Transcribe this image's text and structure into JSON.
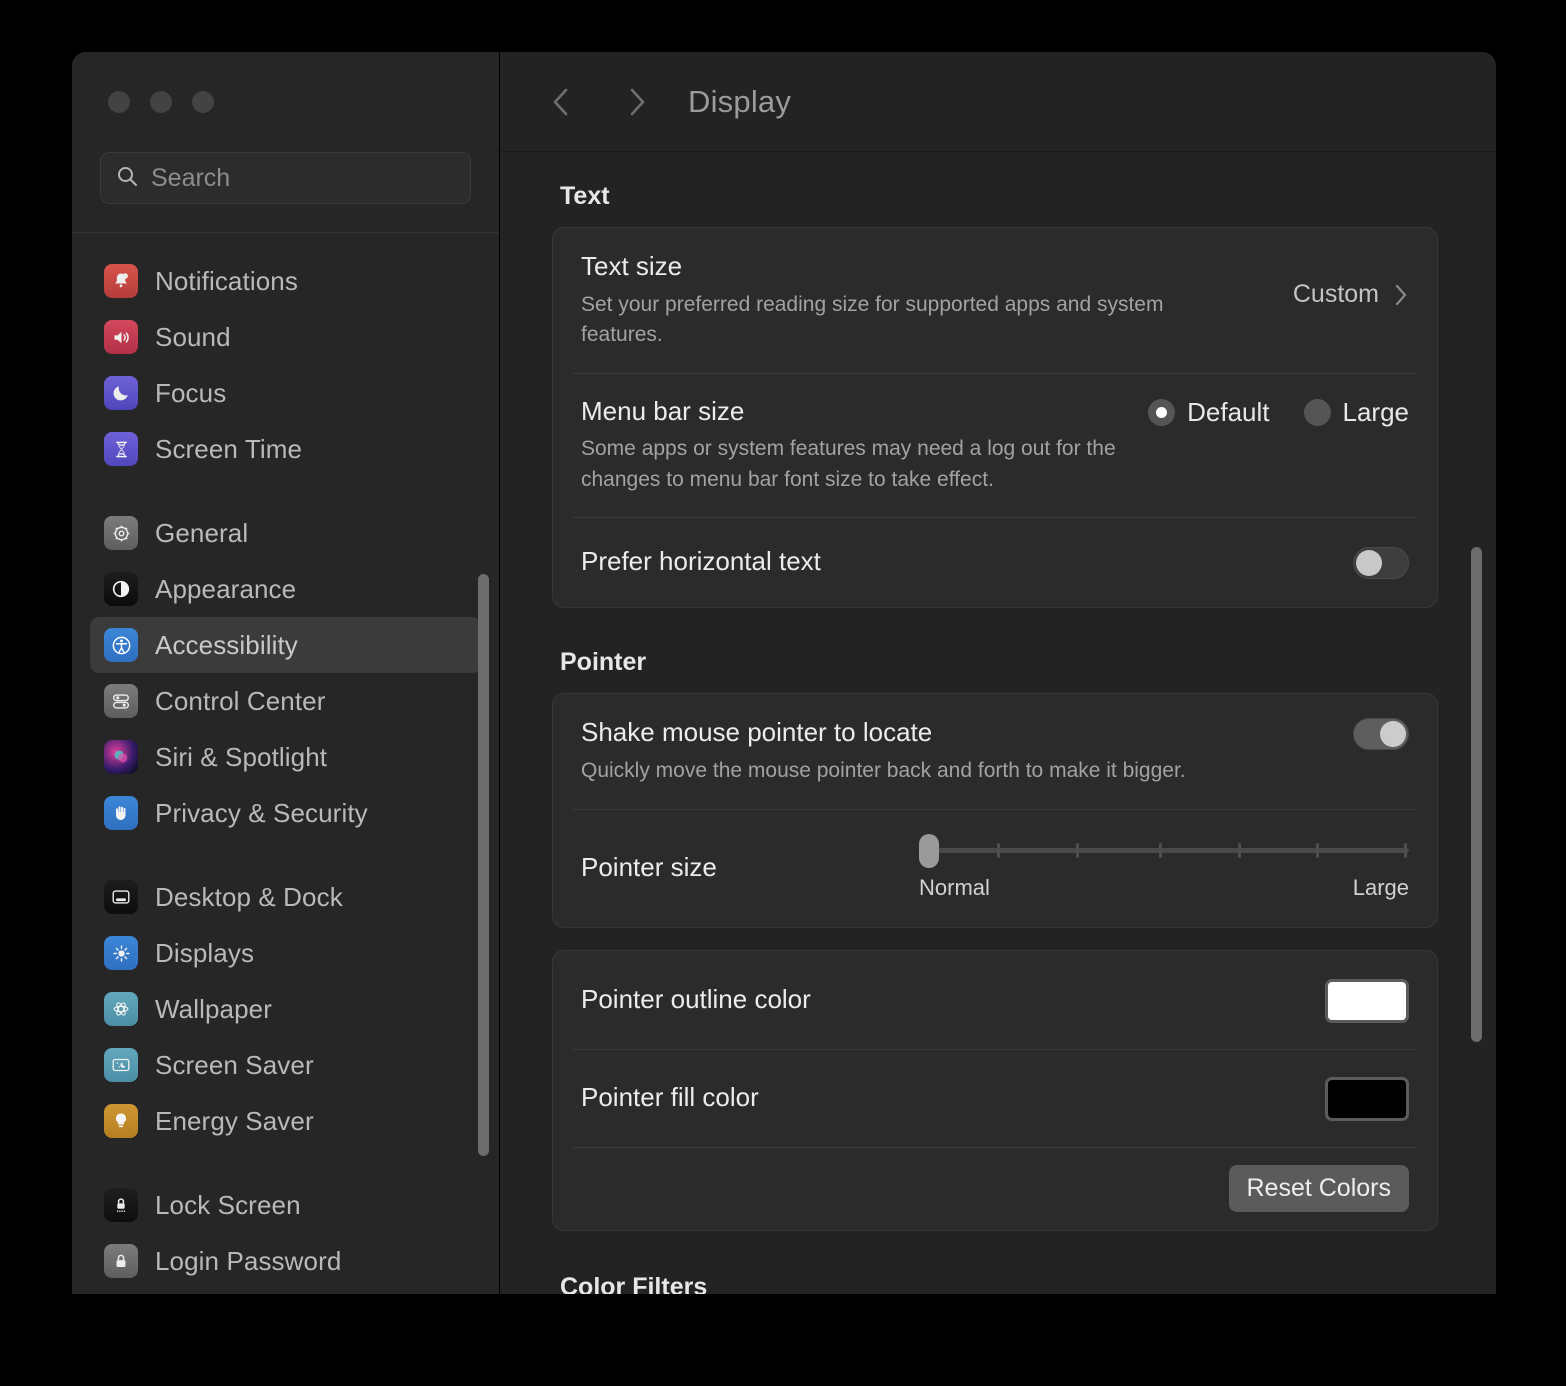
{
  "window": {
    "traffic_lights": [
      "close-button",
      "minimize-button",
      "maximize-button"
    ]
  },
  "sidebar": {
    "search": {
      "placeholder": "Search",
      "value": "",
      "icon": "search-icon"
    },
    "groups": [
      {
        "items": [
          {
            "label": "Notifications",
            "icon": "notifications-icon",
            "selected": false
          },
          {
            "label": "Sound",
            "icon": "sound-icon",
            "selected": false
          },
          {
            "label": "Focus",
            "icon": "focus-icon",
            "selected": false
          },
          {
            "label": "Screen Time",
            "icon": "screen-time-icon",
            "selected": false
          }
        ]
      },
      {
        "items": [
          {
            "label": "General",
            "icon": "general-icon",
            "selected": false
          },
          {
            "label": "Appearance",
            "icon": "appearance-icon",
            "selected": false
          },
          {
            "label": "Accessibility",
            "icon": "accessibility-icon",
            "selected": true
          },
          {
            "label": "Control Center",
            "icon": "control-center-icon",
            "selected": false
          },
          {
            "label": "Siri & Spotlight",
            "icon": "siri-icon",
            "selected": false
          },
          {
            "label": "Privacy & Security",
            "icon": "privacy-icon",
            "selected": false
          }
        ]
      },
      {
        "items": [
          {
            "label": "Desktop & Dock",
            "icon": "desktop-dock-icon",
            "selected": false
          },
          {
            "label": "Displays",
            "icon": "displays-icon",
            "selected": false
          },
          {
            "label": "Wallpaper",
            "icon": "wallpaper-icon",
            "selected": false
          },
          {
            "label": "Screen Saver",
            "icon": "screen-saver-icon",
            "selected": false
          },
          {
            "label": "Energy Saver",
            "icon": "energy-saver-icon",
            "selected": false
          }
        ]
      },
      {
        "items": [
          {
            "label": "Lock Screen",
            "icon": "lock-screen-icon",
            "selected": false
          },
          {
            "label": "Login Password",
            "icon": "login-password-icon",
            "selected": false
          }
        ]
      }
    ]
  },
  "header": {
    "back_icon": "chevron-left-icon",
    "forward_icon": "chevron-right-icon",
    "title": "Display"
  },
  "main": {
    "text_section": {
      "heading": "Text",
      "text_size": {
        "title": "Text size",
        "description": "Set your preferred reading size for supported apps and system features.",
        "value": "Custom",
        "chevron": "chevron-right-icon"
      },
      "menu_bar_size": {
        "title": "Menu bar size",
        "description": "Some apps or system features may need a log out for the changes to menu bar font size to take effect.",
        "options": [
          {
            "label": "Default",
            "selected": true
          },
          {
            "label": "Large",
            "selected": false
          }
        ]
      },
      "prefer_horizontal_text": {
        "title": "Prefer horizontal text",
        "enabled": false
      }
    },
    "pointer_section": {
      "heading": "Pointer",
      "shake_pointer": {
        "title": "Shake mouse pointer to locate",
        "description": "Quickly move the mouse pointer back and forth to make it bigger.",
        "enabled": true
      },
      "pointer_size": {
        "title": "Pointer size",
        "min_label": "Normal",
        "max_label": "Large",
        "value": 0,
        "ticks": 7
      },
      "outline_color": {
        "title": "Pointer outline color",
        "color": "#ffffff"
      },
      "fill_color": {
        "title": "Pointer fill color",
        "color": "#000000"
      },
      "reset_button": "Reset Colors"
    },
    "color_filters_section": {
      "heading": "Color Filters",
      "swatch_colors": [
        "#e8322a",
        "#f07f1a",
        "#f2d411",
        "#3fc14a",
        "#2f9e3d",
        "#23a8a8",
        "#5fc3ef",
        "#1940e0",
        "#9b2fe0",
        "#c355e8",
        "#ec27c8",
        "#b0308c",
        "#c02060",
        "#d07a1c"
      ]
    }
  },
  "scrollbars": {
    "sidebar": "sidebar-scrollbar",
    "main": "main-scrollbar"
  }
}
